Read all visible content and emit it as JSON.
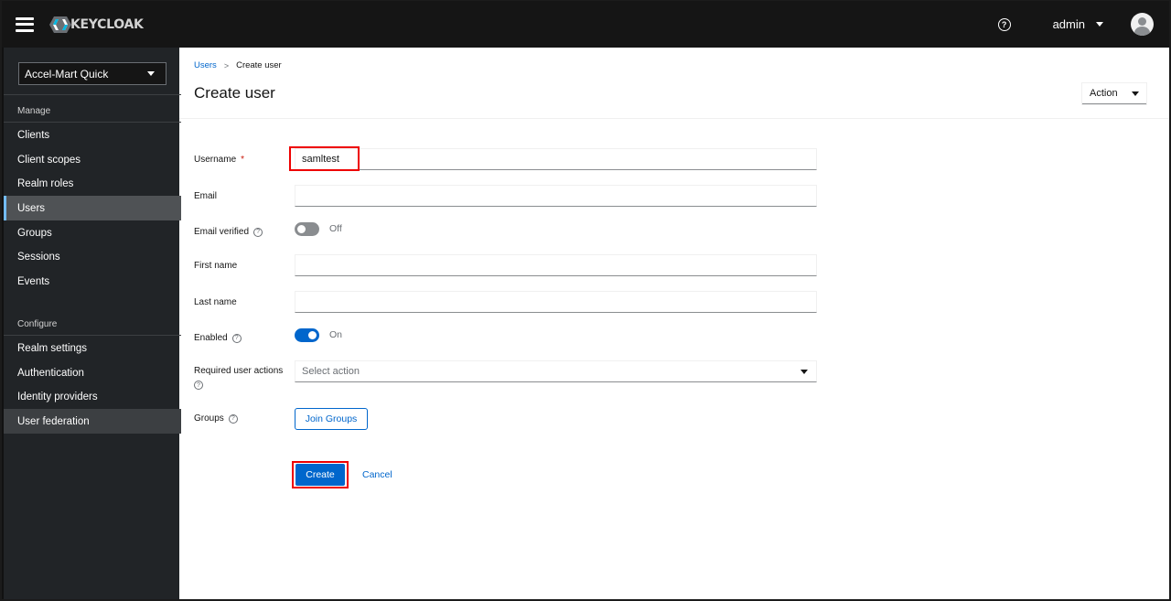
{
  "masthead": {
    "brand": "KEYCLOAK",
    "user_name": "admin",
    "icons": {
      "menu": "hamburger-icon",
      "help": "help-icon",
      "user_caret": "caret-down-icon",
      "avatar": "avatar-icon"
    }
  },
  "sidebar": {
    "realm": "Accel-Mart Quick",
    "sections": [
      {
        "title": "Manage",
        "items": [
          {
            "label": "Clients",
            "active": false
          },
          {
            "label": "Client scopes",
            "active": false
          },
          {
            "label": "Realm roles",
            "active": false
          },
          {
            "label": "Users",
            "active": true
          },
          {
            "label": "Groups",
            "active": false
          },
          {
            "label": "Sessions",
            "active": false
          },
          {
            "label": "Events",
            "active": false
          }
        ]
      },
      {
        "title": "Configure",
        "items": [
          {
            "label": "Realm settings",
            "active": false
          },
          {
            "label": "Authentication",
            "active": false
          },
          {
            "label": "Identity providers",
            "active": false
          },
          {
            "label": "User federation",
            "active": false,
            "hover": true
          }
        ]
      }
    ]
  },
  "header": {
    "breadcrumb": [
      {
        "label": "Users",
        "link": true
      },
      {
        "label": "Create user",
        "link": false
      }
    ],
    "separator": ">",
    "title": "Create user",
    "action_label": "Action"
  },
  "form": {
    "username": {
      "label": "Username",
      "required_mark": "*",
      "value": "samltest"
    },
    "email": {
      "label": "Email",
      "value": ""
    },
    "email_verified": {
      "label": "Email verified",
      "state": "Off"
    },
    "first_name": {
      "label": "First name",
      "value": ""
    },
    "last_name": {
      "label": "Last name",
      "value": ""
    },
    "enabled": {
      "label": "Enabled",
      "state": "On"
    },
    "required_actions": {
      "label": "Required user actions",
      "placeholder": "Select action"
    },
    "groups": {
      "label": "Groups",
      "button": "Join Groups"
    },
    "help_glyph": "?",
    "create_label": "Create",
    "cancel_label": "Cancel"
  },
  "colors": {
    "masthead_bg": "#151515",
    "sidebar_bg": "#212427",
    "primary": "#0066cc",
    "annotation_highlight": "#ee0000"
  }
}
